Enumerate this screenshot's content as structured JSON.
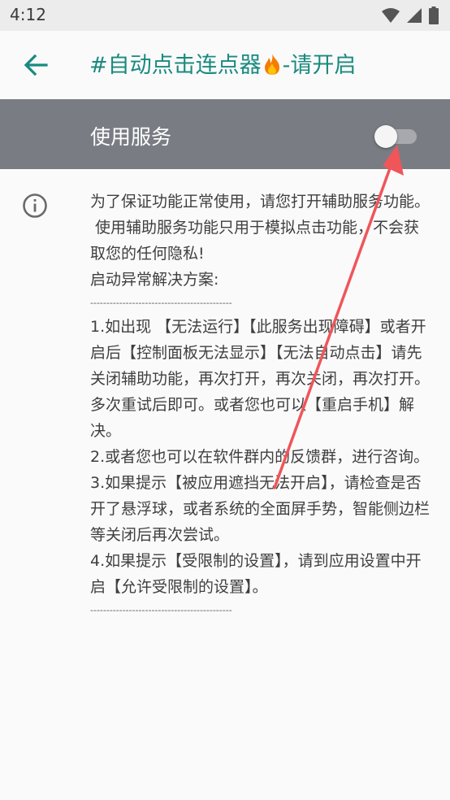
{
  "status_bar": {
    "time": "4:12"
  },
  "app_bar": {
    "title": "#自动点击连点器",
    "title_suffix": "-请开启",
    "title_emoji": "flame-icon"
  },
  "service": {
    "label": "使用服务",
    "enabled": false
  },
  "content": {
    "paragraphs": [
      "为了保证功能正常使用，请您打开辅助服务功能。\n 使用辅助服务功能只用于模拟点击功能，不会获取您的任何隐私!",
      "",
      "启动异常解决方案:",
      "--------------------------------------------",
      "",
      "1.如出现 【无法运行】【此服务出现障碍】或者开启后【控制面板无法显示】【无法自动点击】请先关闭辅助功能，再次打开，再次关闭，再次打开。多次重试后即可。或者您也可以【重启手机】解决。",
      "",
      "2.或者您也可以在软件群内的反馈群，进行咨询。",
      "",
      "3.如果提示【被应用遮挡无法开启】，请检查是否开了悬浮球，或者系统的全面屏手势，智能侧边栏等关闭后再次尝试。",
      "4.如果提示【受限制的设置】，请到应用设置中开启【允许受限制的设置】。",
      "--------------------------------------------"
    ]
  },
  "colors": {
    "accent": "#1a8a7f",
    "service_bar": "#797d83",
    "annotation_arrow": "#f0555a"
  }
}
